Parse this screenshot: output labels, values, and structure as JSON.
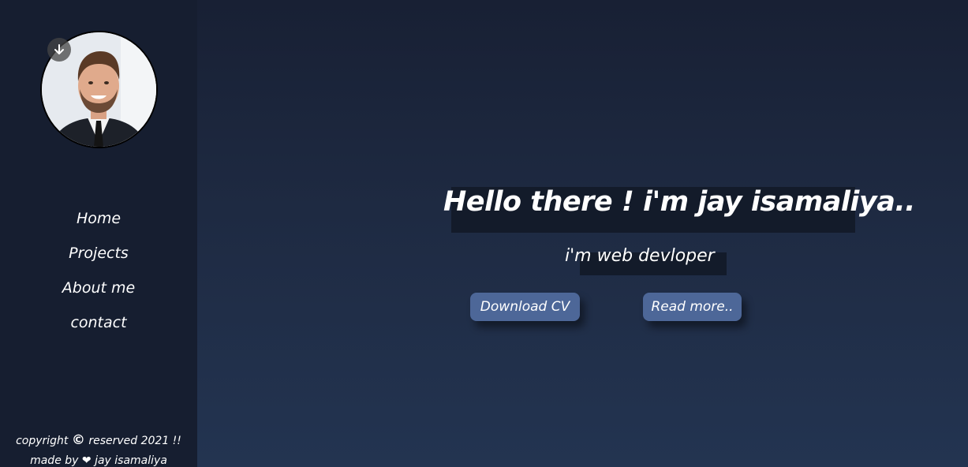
{
  "sidebar": {
    "nav": [
      {
        "label": "Home"
      },
      {
        "label": "Projects"
      },
      {
        "label": "About me"
      },
      {
        "label": "contact"
      }
    ],
    "footer": {
      "copyright_prefix": "copyright",
      "copyright_symbol": "©",
      "copyright_suffix": "reserved 2021 !!",
      "made_by_prefix": "made by",
      "heart_symbol": "❤",
      "made_by_name": "jay isamaliya"
    }
  },
  "hero": {
    "headline": "Hello there ! i'm jay isamaliya..",
    "subline": "i'm web devloper",
    "buttons": {
      "download_cv": "Download CV",
      "read_more": "Read more.."
    }
  },
  "icons": {
    "avatar": "profile-photo",
    "download_badge": "arrow-down-icon",
    "heart": "heart-icon",
    "copyright": "copyright-icon"
  },
  "colors": {
    "sidebar_bg": "#161e30",
    "main_bg_top": "#182034",
    "main_bg_bottom": "#233451",
    "button_bg": "#4d6798",
    "text": "#ffffff"
  }
}
